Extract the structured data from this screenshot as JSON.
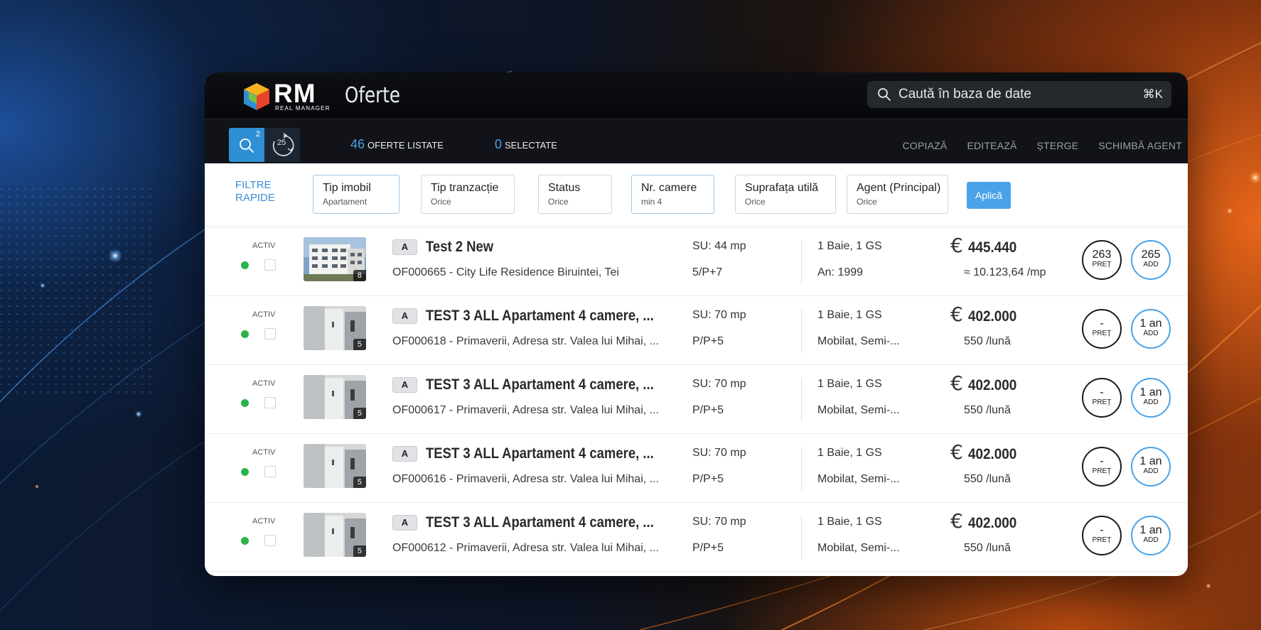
{
  "app": {
    "logo_text": "RM",
    "logo_subtext": "REAL MANAGER",
    "page_title": "Oferte"
  },
  "search": {
    "placeholder": "Caută în baza de date",
    "shortcut": "⌘K"
  },
  "toolbar": {
    "search_badge": "2",
    "history_count": "25",
    "listed_count": "46",
    "listed_label": "OFERTE LISTATE",
    "selected_count": "0",
    "selected_label": "SELECTATE",
    "actions": [
      "COPIAZĂ",
      "EDITEAZĂ",
      "ȘTERGE",
      "SCHIMBĂ AGENT"
    ]
  },
  "filters": {
    "label_line1": "FILTRE",
    "label_line2": "RAPIDE",
    "items": [
      {
        "title": "Tip imobil",
        "value": "Apartament"
      },
      {
        "title": "Tip tranzacție",
        "value": "Orice"
      },
      {
        "title": "Status",
        "value": "Orice"
      },
      {
        "title": "Nr. camere",
        "value": "min 4"
      },
      {
        "title": "Suprafața utilă",
        "value": "Orice"
      },
      {
        "title": "Agent (Principal)",
        "value": "Orice"
      }
    ],
    "apply_label": "Aplică"
  },
  "rows": [
    {
      "status": "ACTIV",
      "photo_count": "8",
      "class": "A",
      "title": "Test 2 New",
      "address": "OF000665 - City Life Residence Biruintei, Tei",
      "su": "SU: 44 mp",
      "floor": "5/P+7",
      "baie": "1 Baie, 1 GS",
      "extra": "An: 1999",
      "currency": "€",
      "price": "445.440",
      "sub_price": "≈ 10.123,64 /mp",
      "circle1_value": "263",
      "circle1_label": "PREȚ",
      "circle2_value": "265",
      "circle2_label": "ADD"
    },
    {
      "status": "ACTIV",
      "photo_count": "5",
      "class": "A",
      "title": "TEST 3 ALL Apartament 4 camere, ...",
      "address": "OF000618 - Primaverii, Adresa str. Valea lui Mihai, ...",
      "su": "SU: 70 mp",
      "floor": "P/P+5",
      "baie": "1 Baie, 1 GS",
      "extra": "Mobilat, Semi-...",
      "currency": "€",
      "price": "402.000",
      "sub_price": "550 /lună",
      "circle1_value": "-",
      "circle1_label": "PREȚ",
      "circle2_value": "1 an",
      "circle2_label": "ADD"
    },
    {
      "status": "ACTIV",
      "photo_count": "5",
      "class": "A",
      "title": "TEST 3 ALL Apartament 4 camere, ...",
      "address": "OF000617 - Primaverii, Adresa str. Valea lui Mihai, ...",
      "su": "SU: 70 mp",
      "floor": "P/P+5",
      "baie": "1 Baie, 1 GS",
      "extra": "Mobilat, Semi-...",
      "currency": "€",
      "price": "402.000",
      "sub_price": "550 /lună",
      "circle1_value": "-",
      "circle1_label": "PREȚ",
      "circle2_value": "1 an",
      "circle2_label": "ADD"
    },
    {
      "status": "ACTIV",
      "photo_count": "5",
      "class": "A",
      "title": "TEST 3 ALL Apartament 4 camere, ...",
      "address": "OF000616 - Primaverii, Adresa str. Valea lui Mihai, ...",
      "su": "SU: 70 mp",
      "floor": "P/P+5",
      "baie": "1 Baie, 1 GS",
      "extra": "Mobilat, Semi-...",
      "currency": "€",
      "price": "402.000",
      "sub_price": "550 /lună",
      "circle1_value": "-",
      "circle1_label": "PREȚ",
      "circle2_value": "1 an",
      "circle2_label": "ADD"
    },
    {
      "status": "ACTIV",
      "photo_count": "5",
      "class": "A",
      "title": "TEST 3 ALL Apartament 4 camere, ...",
      "address": "OF000612 - Primaverii, Adresa str. Valea lui Mihai, ...",
      "su": "SU: 70 mp",
      "floor": "P/P+5",
      "baie": "1 Baie, 1 GS",
      "extra": "Mobilat, Semi-...",
      "currency": "€",
      "price": "402.000",
      "sub_price": "550 /lună",
      "circle1_value": "-",
      "circle1_label": "PREȚ",
      "circle2_value": "1 an",
      "circle2_label": "ADD"
    }
  ],
  "colors": {
    "accent": "#4aa3e8",
    "status_active": "#2cb34a",
    "topbar": "#0d0f13"
  }
}
